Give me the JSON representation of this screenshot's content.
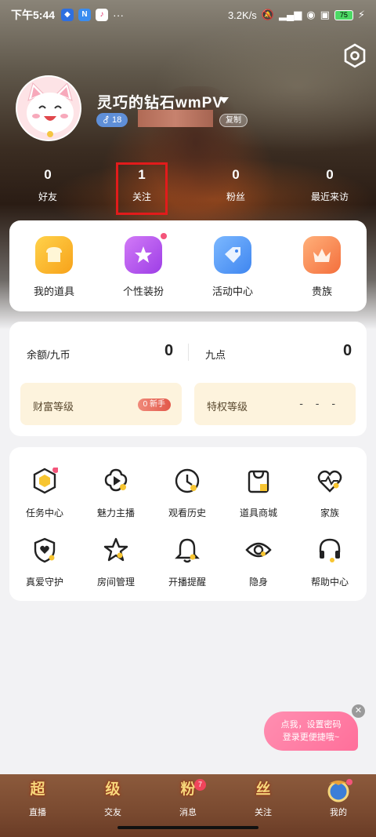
{
  "status_bar": {
    "time": "下午5:44",
    "dots": "···",
    "network_speed": "3.2K/s",
    "battery": "75"
  },
  "profile": {
    "username": "灵巧的钻石wmPV",
    "level": "18",
    "copy_label": "复制"
  },
  "stats": [
    {
      "value": "0",
      "label": "好友"
    },
    {
      "value": "1",
      "label": "关注"
    },
    {
      "value": "0",
      "label": "粉丝"
    },
    {
      "value": "0",
      "label": "最近来访"
    }
  ],
  "tools": [
    {
      "label": "我的道具",
      "icon": "toast-icon",
      "color": "#f7b12a"
    },
    {
      "label": "个性装扮",
      "icon": "magic-star-icon",
      "color": "#b15cf0"
    },
    {
      "label": "活动中心",
      "icon": "tag-icon",
      "color": "#4e9bf5"
    },
    {
      "label": "贵族",
      "icon": "crown-icon",
      "color": "#f7915a"
    }
  ],
  "wallet": {
    "balance_label": "余额/九币",
    "balance_value": "0",
    "points_label": "九点",
    "points_value": "0",
    "wealth_label": "财富等级",
    "wealth_badge": "0 新手",
    "privilege_label": "特权等级",
    "privilege_value": "- - -"
  },
  "grid": [
    {
      "label": "任务中心",
      "icon": "task-icon"
    },
    {
      "label": "魅力主播",
      "icon": "flower-play-icon"
    },
    {
      "label": "观看历史",
      "icon": "clock-icon"
    },
    {
      "label": "道具商城",
      "icon": "shopping-bag-icon"
    },
    {
      "label": "家族",
      "icon": "heart-pulse-icon"
    },
    {
      "label": "真爱守护",
      "icon": "shield-heart-icon"
    },
    {
      "label": "房间管理",
      "icon": "star-icon"
    },
    {
      "label": "开播提醒",
      "icon": "bell-icon"
    },
    {
      "label": "隐身",
      "icon": "eye-icon"
    },
    {
      "label": "帮助中心",
      "icon": "headset-icon"
    }
  ],
  "bubble": {
    "line1": "点我，设置密码",
    "line2": "登录更便捷哦~"
  },
  "bottom_nav": [
    {
      "glyph": "超",
      "label": "直播"
    },
    {
      "glyph": "级",
      "label": "交友"
    },
    {
      "glyph": "粉",
      "label": "消息",
      "badge": "7"
    },
    {
      "glyph": "丝",
      "label": "关注"
    },
    {
      "glyph": "",
      "label": "我的"
    }
  ],
  "colors": {
    "accent_pink": "#ff6f9a",
    "highlight_red": "#e21b1b",
    "icon_yellow": "#f7c531"
  }
}
